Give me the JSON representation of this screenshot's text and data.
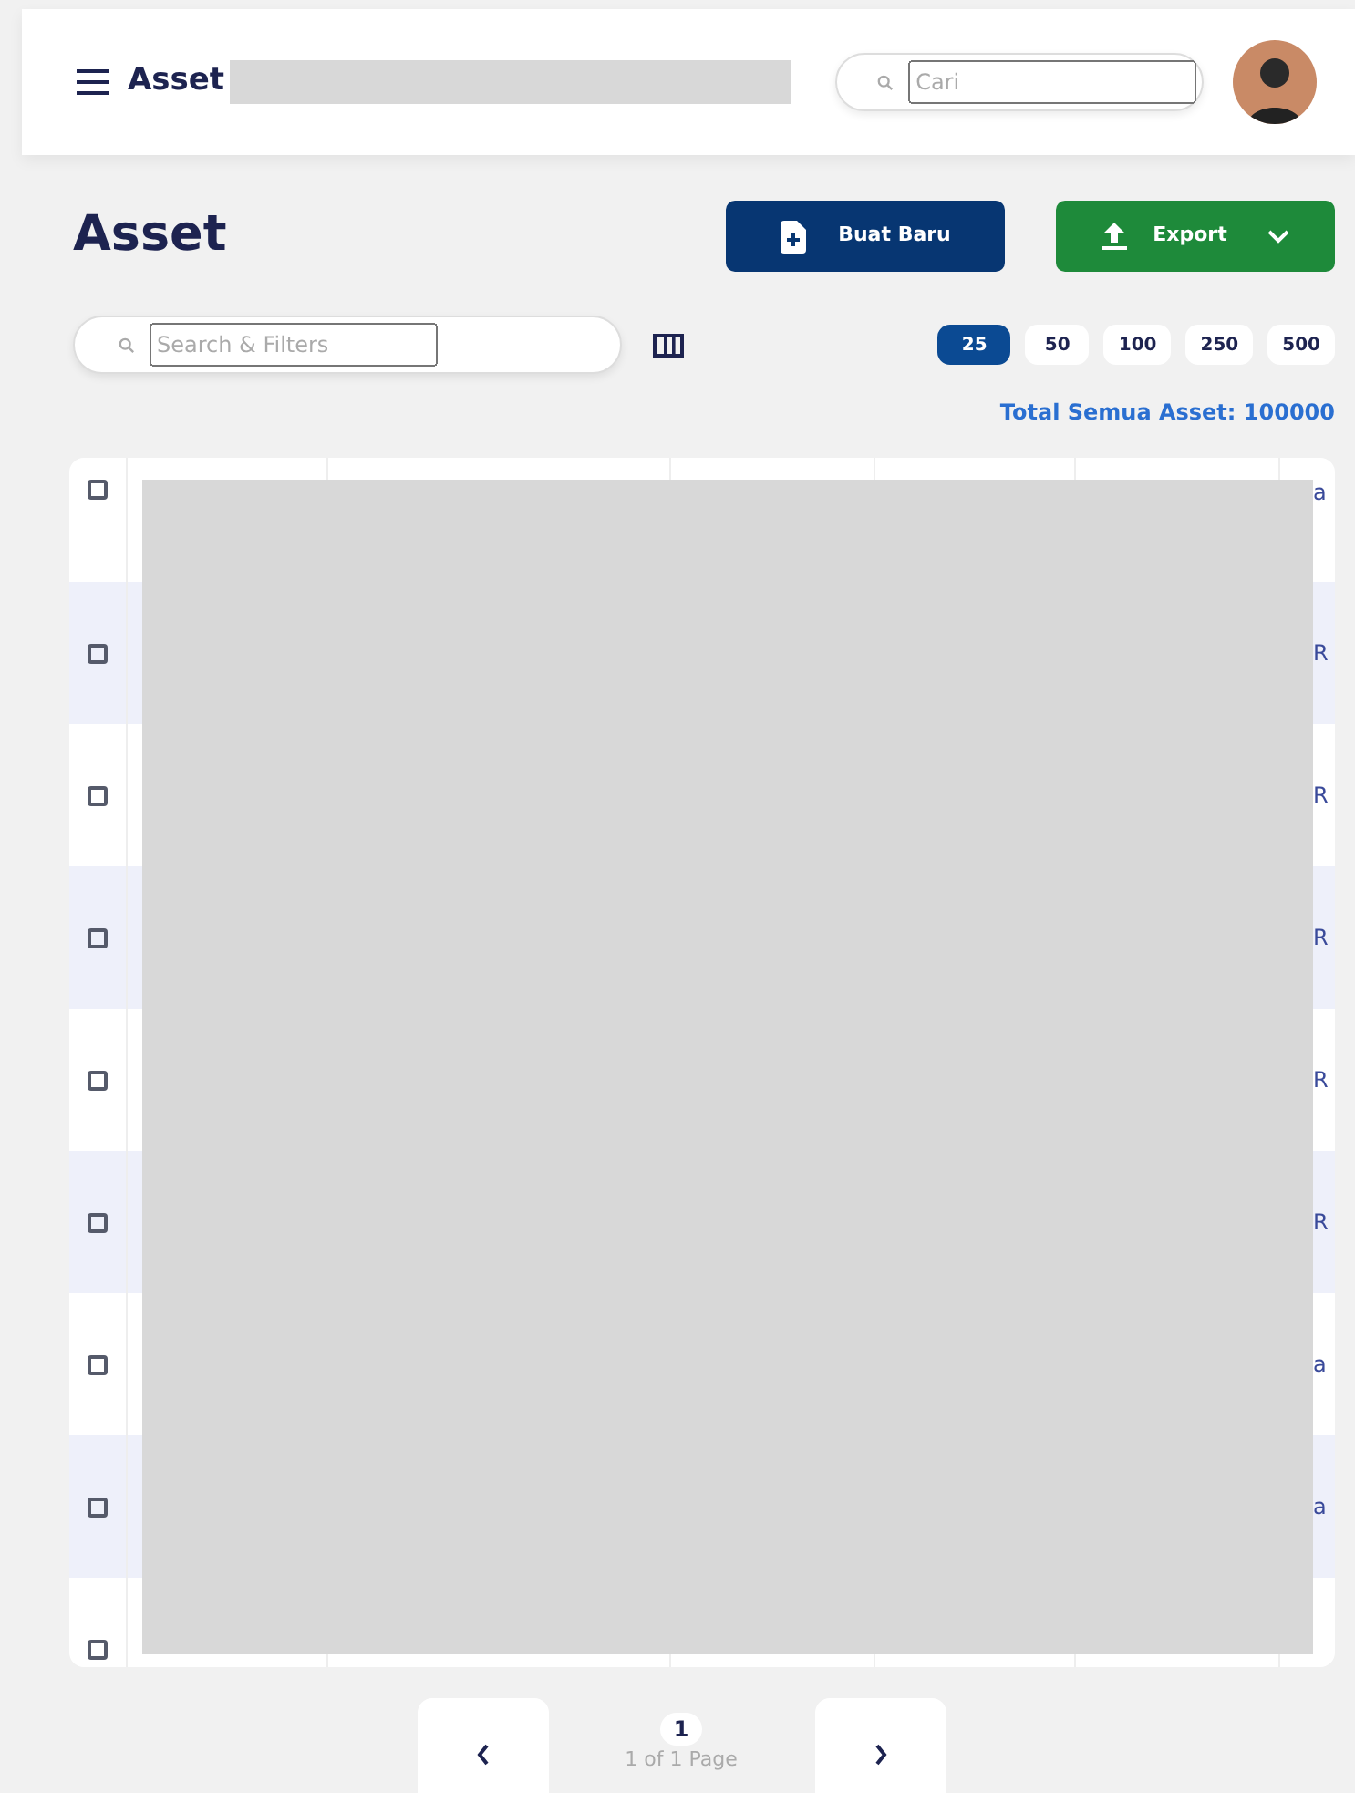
{
  "header": {
    "title": "Asset",
    "search": {
      "placeholder": "Cari"
    }
  },
  "page": {
    "title": "Asset",
    "actions": [
      {
        "label": "Buat Baru",
        "kind": "create"
      },
      {
        "label": "Export",
        "kind": "export"
      }
    ]
  },
  "filter": {
    "placeholder": "Search & Filters"
  },
  "page_sizes": [
    {
      "label": "25",
      "selected": true
    },
    {
      "label": "50",
      "selected": false
    },
    {
      "label": "100",
      "selected": false
    },
    {
      "label": "250",
      "selected": false
    },
    {
      "label": "500",
      "selected": false
    }
  ],
  "total": "Total Semua Asset: 100000",
  "table": {
    "rows": [
      {
        "checked": false,
        "column_7": "a"
      },
      {
        "checked": false,
        "column_7": "R"
      },
      {
        "checked": false,
        "column_7": "R"
      },
      {
        "checked": false,
        "column_7": "R"
      },
      {
        "checked": false,
        "column_7": "R"
      },
      {
        "checked": false,
        "column_7": "R"
      },
      {
        "checked": false,
        "column_7": "a"
      },
      {
        "checked": false,
        "column_7": "a"
      },
      {
        "checked": false
      }
    ]
  },
  "pagination": {
    "current": "1",
    "summary": "1 of 1 Page"
  }
}
